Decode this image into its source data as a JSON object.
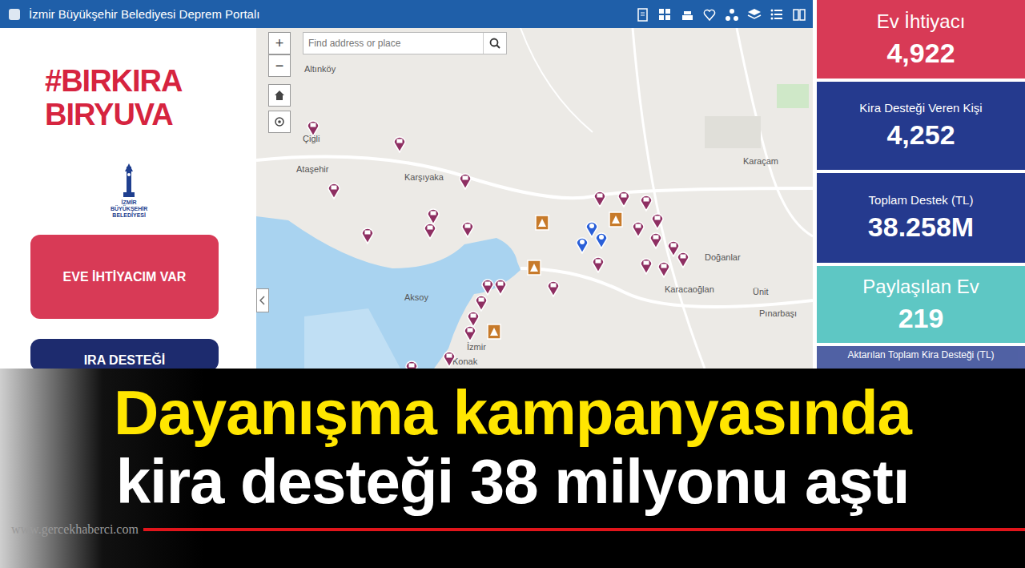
{
  "window": {
    "title": "İzmir Büyükşehir Belediyesi Deprem Portalı"
  },
  "campaign_logo": [
    "#BIRKIRA",
    "BIRYUVA"
  ],
  "municipality_logo": [
    "İZMİR",
    "BÜYÜKŞEHİR",
    "BELEDİYESİ"
  ],
  "buttons": [
    {
      "label": "EVE İHTİYACIM VAR",
      "color": "#d83a56"
    },
    {
      "label": "IRA DESTEĞİ",
      "color": "#1d2b6e"
    }
  ],
  "map": {
    "search": {
      "placeholder": "Find address or place"
    },
    "controls": [
      "+",
      "−"
    ],
    "labels": [
      "Altınköy",
      "Çiğli",
      "Ataşehir",
      "Karşıyaka",
      "Aksoy",
      "İzmir",
      "Konak",
      "Karacaoğlan",
      "Ünit",
      "Pınarbaşı",
      "Doğanlar",
      "Karaçam"
    ],
    "pins": [
      {
        "kind": "home",
        "color": "#8e2f62"
      },
      {
        "kind": "home",
        "color": "#8e2f62"
      },
      {
        "kind": "home",
        "color": "#8e2f62"
      },
      {
        "kind": "home",
        "color": "#8e2f62"
      },
      {
        "kind": "home",
        "color": "#8e2f62"
      },
      {
        "kind": "home",
        "color": "#8e2f62"
      },
      {
        "kind": "home",
        "color": "#8e2f62"
      },
      {
        "kind": "home",
        "color": "#8e2f62"
      },
      {
        "kind": "home",
        "color": "#8e2f62"
      },
      {
        "kind": "home",
        "color": "#8e2f62"
      },
      {
        "kind": "home",
        "color": "#8e2f62"
      },
      {
        "kind": "home",
        "color": "#8e2f62"
      },
      {
        "kind": "home",
        "color": "#8e2f62"
      },
      {
        "kind": "home",
        "color": "#8e2f62"
      },
      {
        "kind": "home",
        "color": "#8e2f62"
      },
      {
        "kind": "home",
        "color": "#8e2f62"
      },
      {
        "kind": "home",
        "color": "#8e2f62"
      },
      {
        "kind": "home",
        "color": "#8e2f62"
      },
      {
        "kind": "home",
        "color": "#8e2f62"
      },
      {
        "kind": "home",
        "color": "#8e2f62"
      },
      {
        "kind": "home",
        "color": "#8e2f62"
      },
      {
        "kind": "home",
        "color": "#8e2f62"
      },
      {
        "kind": "home",
        "color": "#8e2f62"
      },
      {
        "kind": "home",
        "color": "#8e2f62"
      },
      {
        "kind": "home",
        "color": "#8e2f62"
      },
      {
        "kind": "home",
        "color": "#8e2f62"
      },
      {
        "kind": "home",
        "color": "#8e2f62"
      },
      {
        "kind": "aid",
        "color": "#2a5fd8"
      },
      {
        "kind": "aid",
        "color": "#2a5fd8"
      },
      {
        "kind": "aid",
        "color": "#2a5fd8"
      },
      {
        "kind": "sign",
        "color": "#c77a2a"
      },
      {
        "kind": "sign",
        "color": "#c77a2a"
      },
      {
        "kind": "sign",
        "color": "#c77a2a"
      },
      {
        "kind": "sign",
        "color": "#c77a2a"
      }
    ]
  },
  "stats": [
    {
      "label": "Ev İhtiyacı",
      "value": "4,922",
      "kind": "large",
      "color": "#d83a56"
    },
    {
      "label": "Kira Desteği Veren Kişi",
      "value": "4,252",
      "kind": "small",
      "color": "#253a8e"
    },
    {
      "label": "Toplam Destek (TL)",
      "value": "38.258M",
      "kind": "small",
      "color": "#253a8e"
    },
    {
      "label": "Paylaşılan Ev",
      "value": "219",
      "kind": "large",
      "color": "#5ec7c4"
    },
    {
      "label": "Aktarılan Toplam Kira Desteği (TL)",
      "kind": "small",
      "color": "#253a8e"
    }
  ],
  "headline": {
    "line1": "Dayanışma kampanyasında",
    "line2": "kira desteği 38 milyonu aştı"
  },
  "watermark": "www.gercekhaberci.com"
}
